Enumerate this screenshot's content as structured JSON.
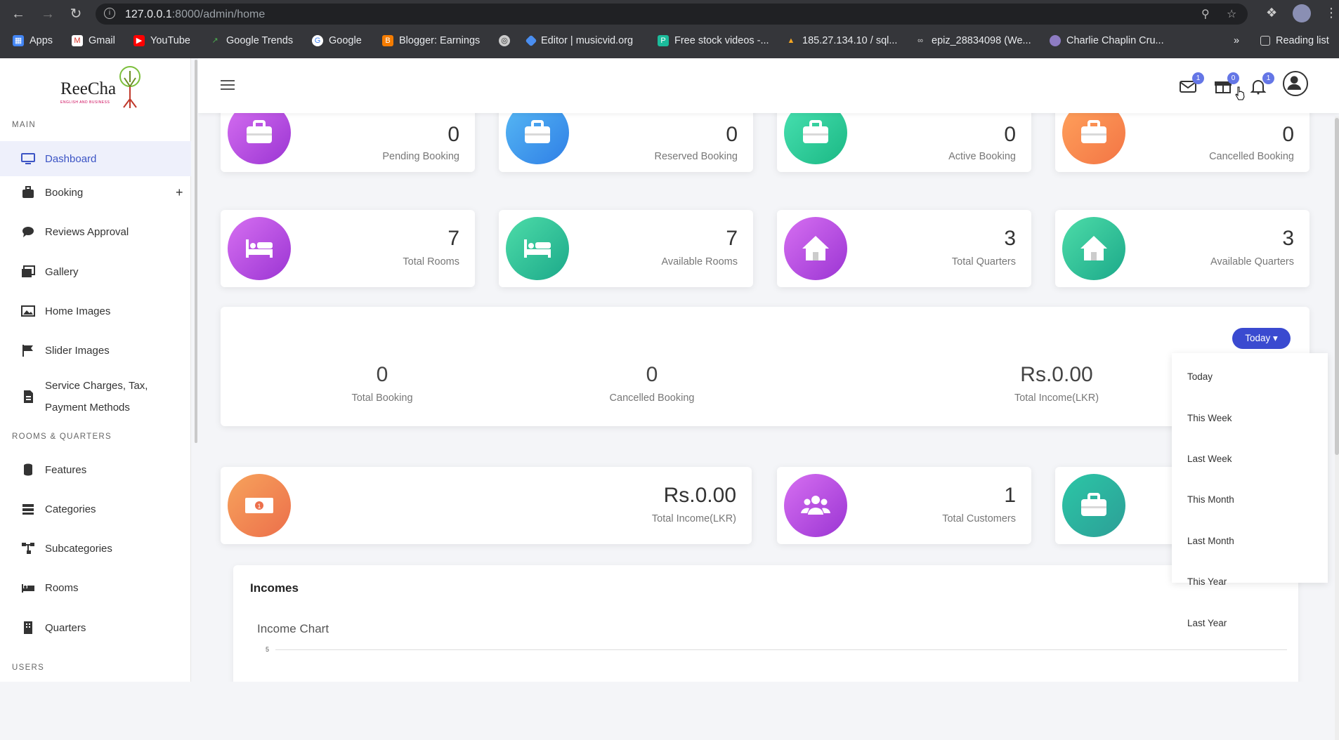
{
  "browser": {
    "url_host": "127.0.0.1",
    "url_rest": ":8000/admin/home",
    "bookmarks": [
      {
        "label": "Apps",
        "icon": "apps-grid-icon"
      },
      {
        "label": "Gmail",
        "icon": "gmail-icon"
      },
      {
        "label": "YouTube",
        "icon": "youtube-icon"
      },
      {
        "label": "Google Trends",
        "icon": "google-trends-icon"
      },
      {
        "label": "Google",
        "icon": "google-icon"
      },
      {
        "label": "Blogger: Earnings",
        "icon": "blogger-icon"
      },
      {
        "label": "",
        "icon": "globe-icon"
      },
      {
        "label": "Editor | musicvid.org",
        "icon": "musicvid-icon"
      },
      {
        "label": "Free stock videos -...",
        "icon": "stock-videos-icon"
      },
      {
        "label": "185.27.134.10 / sql...",
        "icon": "phpmyadmin-icon"
      },
      {
        "label": "epiz_28834098 (We...",
        "icon": "infinityfree-icon"
      },
      {
        "label": "Charlie Chaplin Cru...",
        "icon": "orb-icon"
      }
    ],
    "more": "»",
    "reading_list": "Reading list"
  },
  "sidebar": {
    "logo_text": "ReeCha",
    "logo_sub": "ENGLISH AND BUSINESS",
    "sections": {
      "main": "MAIN",
      "rooms": "ROOMS & QUARTERS",
      "users": "USERS"
    },
    "items": [
      {
        "label": "Dashboard",
        "icon": "monitor-icon"
      },
      {
        "label": "Booking",
        "icon": "suitcase-icon",
        "extra": "+"
      },
      {
        "label": "Reviews Approval",
        "icon": "comment-icon"
      },
      {
        "label": "Gallery",
        "icon": "images-icon"
      },
      {
        "label": "Home Images",
        "icon": "image-icon"
      },
      {
        "label": "Slider Images",
        "icon": "flag-icon"
      },
      {
        "label": "Service Charges, Tax,",
        "label2": "Payment Methods",
        "icon": "file-invoice-icon"
      },
      {
        "label": "Features",
        "icon": "database-icon"
      },
      {
        "label": "Categories",
        "icon": "list-icon"
      },
      {
        "label": "Subcategories",
        "icon": "sitemap-icon"
      },
      {
        "label": "Rooms",
        "icon": "bed-icon"
      },
      {
        "label": "Quarters",
        "icon": "building-icon"
      }
    ]
  },
  "topbar": {
    "mail_count": "1",
    "gift_count": "0",
    "bell_count": "1"
  },
  "stats_row1": [
    {
      "value": "0",
      "label": "Pending Booking",
      "color": "purple"
    },
    {
      "value": "0",
      "label": "Reserved Booking",
      "color": "blue"
    },
    {
      "value": "0",
      "label": "Active Booking",
      "color": "green"
    },
    {
      "value": "0",
      "label": "Cancelled Booking",
      "color": "orange"
    }
  ],
  "stats_row2": [
    {
      "value": "7",
      "label": "Total Rooms",
      "color": "purple"
    },
    {
      "value": "7",
      "label": "Available Rooms",
      "color": "teal"
    },
    {
      "value": "3",
      "label": "Total Quarters",
      "color": "purple"
    },
    {
      "value": "3",
      "label": "Available Quarters",
      "color": "teal"
    }
  ],
  "summary": {
    "total_booking_value": "0",
    "total_booking_label": "Total Booking",
    "cancelled_value": "0",
    "cancelled_label": "Cancelled Booking",
    "income_value": "Rs.0.00",
    "income_label": "Total Income(LKR)",
    "filter_label": "Today"
  },
  "dropdown": [
    "Today",
    "This Week",
    "Last Week",
    "This Month",
    "Last Month",
    "This Year",
    "Last Year"
  ],
  "stats_row3": [
    {
      "value": "Rs.0.00",
      "label": "Total Income(LKR)",
      "color": "orange"
    },
    {
      "value": "1",
      "label": "Total Customers",
      "color": "purple"
    },
    {
      "value": "",
      "label": "",
      "color": "teal"
    }
  ],
  "chart_section": {
    "title": "Incomes",
    "chart_title": "Income Chart",
    "tick": "5"
  },
  "colors": {
    "accent": "#3a4ad0",
    "badge": "#6476e6",
    "active_nav": "#3c54c5"
  }
}
